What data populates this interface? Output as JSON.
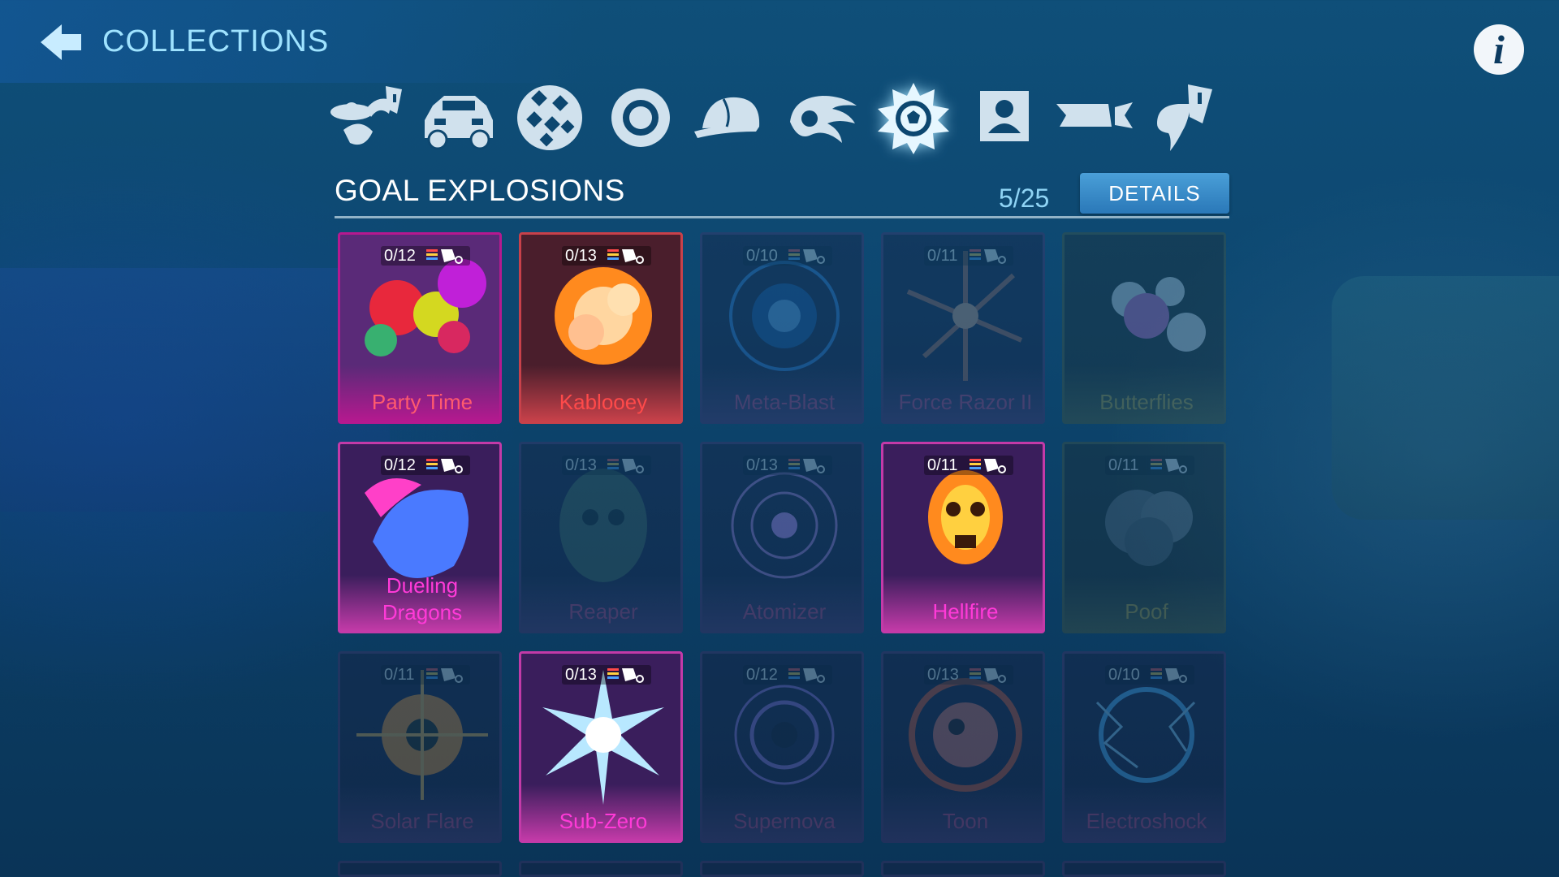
{
  "header": {
    "title": "COLLECTIONS"
  },
  "categories": [
    {
      "name": "toppers-icon",
      "active": false
    },
    {
      "name": "car-body-icon",
      "active": false
    },
    {
      "name": "decal-icon",
      "active": false
    },
    {
      "name": "wheels-icon",
      "active": false
    },
    {
      "name": "hat-icon",
      "active": false
    },
    {
      "name": "rocket-boost-icon",
      "active": false
    },
    {
      "name": "goal-explosion-icon",
      "active": true
    },
    {
      "name": "player-banner-icon",
      "active": false
    },
    {
      "name": "trail-icon",
      "active": false
    },
    {
      "name": "antenna-icon",
      "active": false
    }
  ],
  "section": {
    "title": "GOAL EXPLOSIONS",
    "count": "5/25",
    "details_label": "DETAILS"
  },
  "items": [
    {
      "name": "Party Time",
      "count": "0/12",
      "owned": true,
      "color": "#ff5a6e",
      "frame": "#b5198f",
      "bg": "#5a2a78"
    },
    {
      "name": "Kablooey",
      "count": "0/13",
      "owned": true,
      "color": "#ff4a4a",
      "frame": "#c8414a",
      "bg": "#4a1e2c"
    },
    {
      "name": "Meta-Blast",
      "count": "0/10",
      "owned": false,
      "color": "#d23a7a",
      "frame": "#5a2a64",
      "bg": "#1e1230"
    },
    {
      "name": "Force Razor II",
      "count": "0/11",
      "owned": false,
      "color": "#d23a7a",
      "frame": "#5a2a64",
      "bg": "#1e1230"
    },
    {
      "name": "Butterflies",
      "count": "",
      "owned": false,
      "color": "#c8a830",
      "frame": "#5a5a2a",
      "bg": "#24231a"
    },
    {
      "name": "Dueling\nDragons",
      "count": "0/12",
      "owned": true,
      "color": "#ff3ad8",
      "frame": "#c33aa8",
      "bg": "#3a1e5c"
    },
    {
      "name": "Reaper",
      "count": "0/13",
      "owned": false,
      "color": "#d23a7a",
      "frame": "#5a2a64",
      "bg": "#1e1230"
    },
    {
      "name": "Atomizer",
      "count": "0/13",
      "owned": false,
      "color": "#d23a7a",
      "frame": "#5a2a64",
      "bg": "#1e1230"
    },
    {
      "name": "Hellfire",
      "count": "0/11",
      "owned": true,
      "color": "#ff3ad8",
      "frame": "#c33aa8",
      "bg": "#3a1e5c"
    },
    {
      "name": "Poof",
      "count": "0/11",
      "owned": false,
      "color": "#c8a830",
      "frame": "#5a5a2a",
      "bg": "#24231a"
    },
    {
      "name": "Solar Flare",
      "count": "0/11",
      "owned": false,
      "color": "#d23a7a",
      "frame": "#5a2a64",
      "bg": "#1e1230"
    },
    {
      "name": "Sub-Zero",
      "count": "0/13",
      "owned": true,
      "color": "#ff3ad8",
      "frame": "#c33aa8",
      "bg": "#3a1e5c"
    },
    {
      "name": "Supernova",
      "count": "0/12",
      "owned": false,
      "color": "#d23a7a",
      "frame": "#5a2a64",
      "bg": "#1e1230"
    },
    {
      "name": "Toon",
      "count": "0/13",
      "owned": false,
      "color": "#d23a7a",
      "frame": "#5a2a64",
      "bg": "#1e1230"
    },
    {
      "name": "Electroshock",
      "count": "0/10",
      "owned": false,
      "color": "#d23a7a",
      "frame": "#5a2a64",
      "bg": "#1e1230"
    }
  ]
}
